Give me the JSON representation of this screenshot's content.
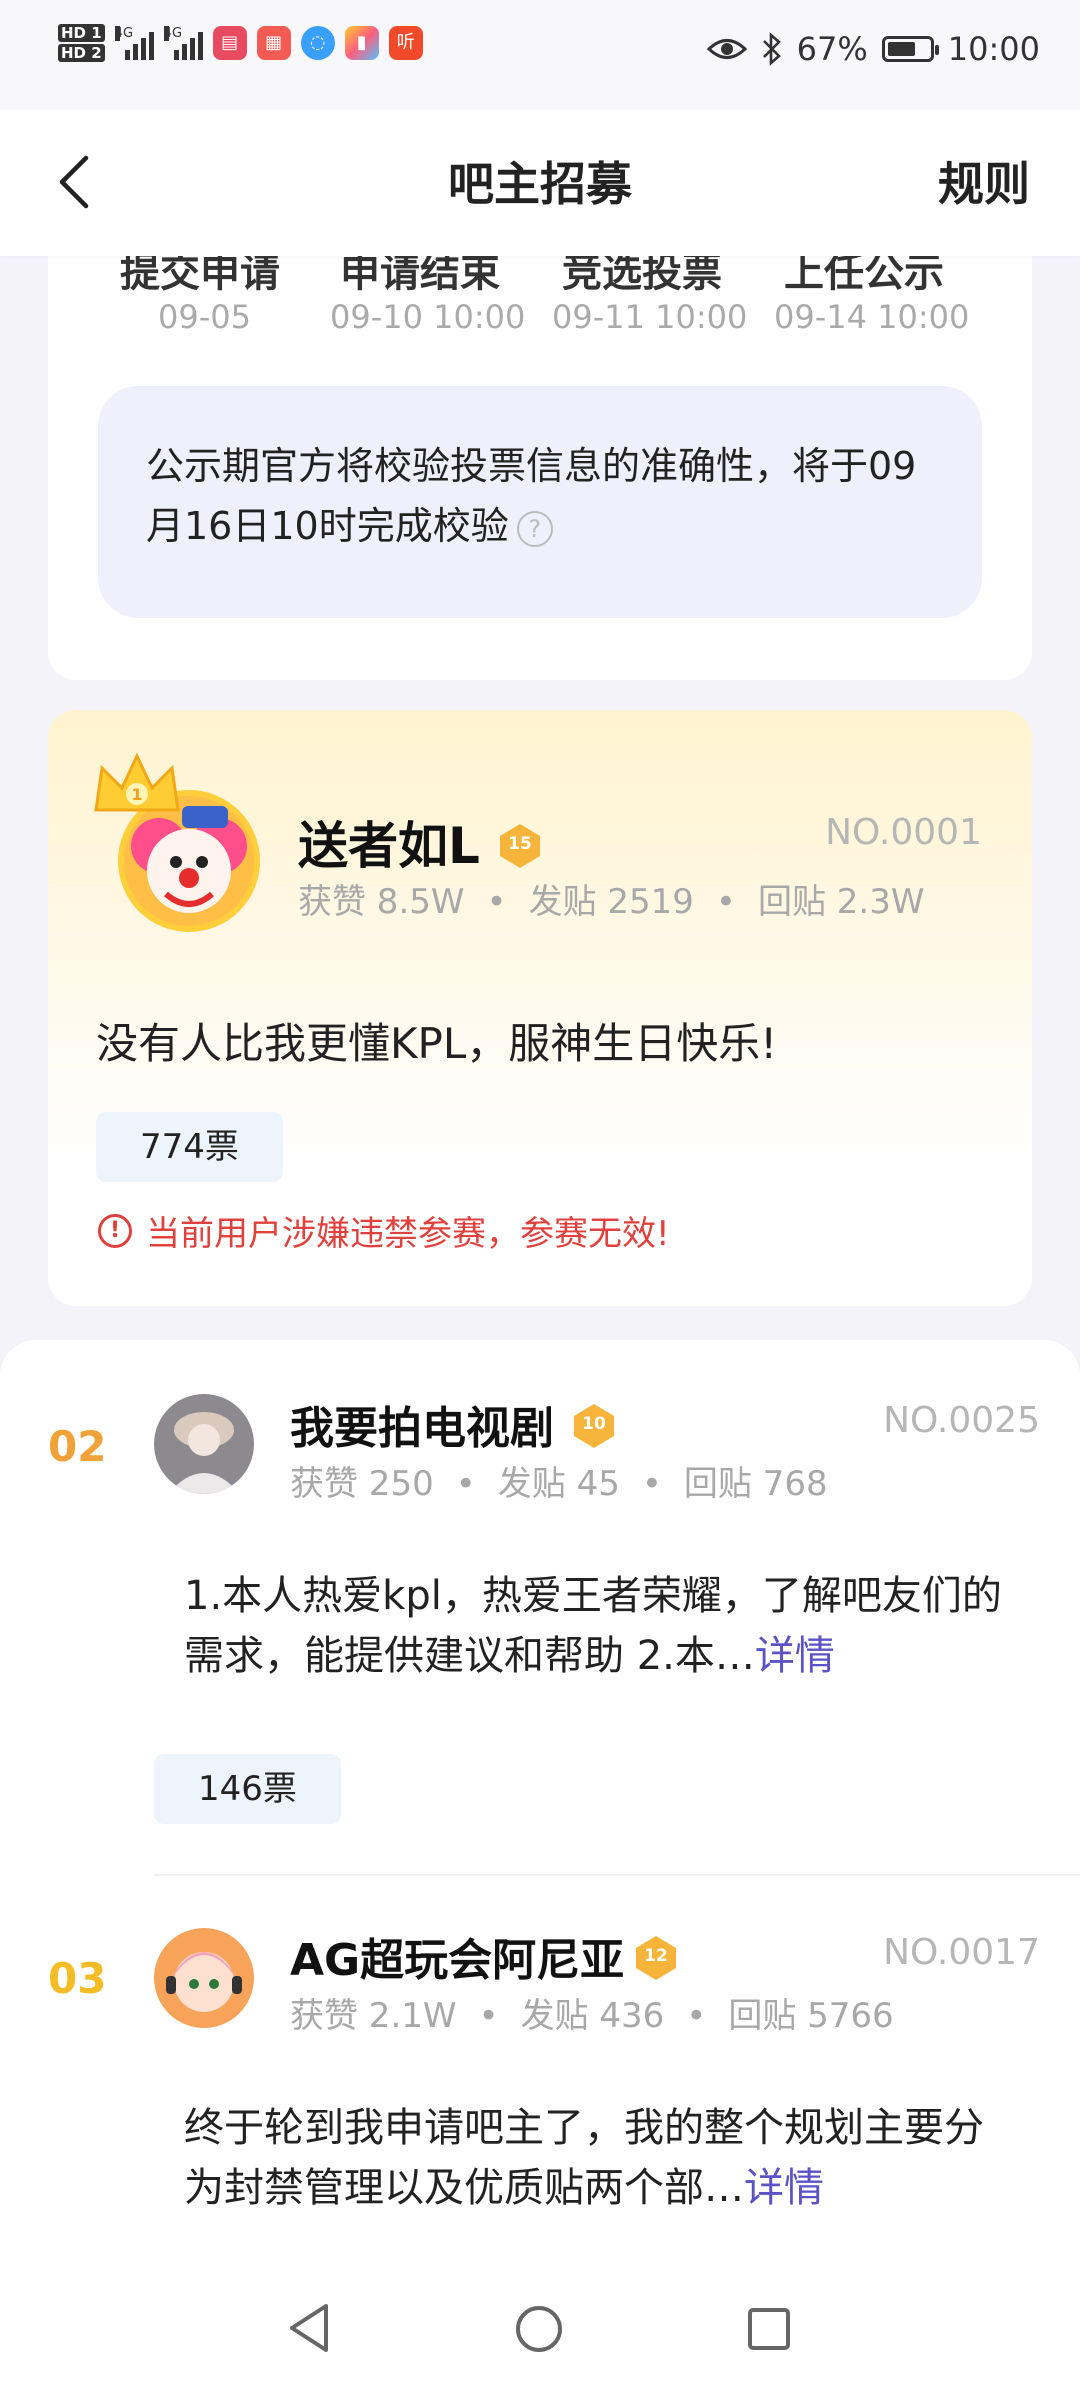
{
  "status_bar": {
    "hd1": "HD 1",
    "hd2": "HD 2",
    "net1": "4G",
    "net2": "4G",
    "apps": [
      "read-app-icon",
      "grid-app-icon",
      "chat-app-icon",
      "flag-app-icon",
      "listen-app-icon"
    ],
    "listen_glyph": "听",
    "battery_text": "67%",
    "battery_level": 0.67,
    "time": "10:00"
  },
  "nav": {
    "title": "吧主招募",
    "rules": "规则"
  },
  "steps": [
    {
      "name": "提交申请",
      "date": "09-05"
    },
    {
      "name": "申请结束",
      "date": "09-10 10:00"
    },
    {
      "name": "竞选投票",
      "date": "09-11 10:00"
    },
    {
      "name": "上任公示",
      "date": "09-14 10:00"
    }
  ],
  "notice": {
    "text": "公示期官方将校验投票信息的准确性，将于09月16日10时完成校验",
    "help": "?"
  },
  "top_candidate": {
    "crown_rank": "1",
    "name": "送者如L",
    "level": "15",
    "number": "NO.0001",
    "likes": "获赞 8.5W",
    "posts": "发贴 2519",
    "replies": "回贴 2.3W",
    "intro": "没有人比我更懂KPL，服神生日快乐!",
    "votes": "774票",
    "warning": "当前用户涉嫌违禁参赛，参赛无效!",
    "warn_icon": "!"
  },
  "candidates": [
    {
      "rank": "02",
      "name": "我要拍电视剧",
      "level": "10",
      "number": "NO.0025",
      "likes": "获赞 250",
      "posts": "发贴 45",
      "replies": "回贴 768",
      "intro": "1.本人热爱kpl，热爱王者荣耀，了解吧友们的需求，能提供建议和帮助 2.本…",
      "more": "详情",
      "votes": "146票"
    },
    {
      "rank": "03",
      "name": "AG超玩会阿尼亚",
      "level": "12",
      "number": "NO.0017",
      "likes": "获赞 2.1W",
      "posts": "发贴 436",
      "replies": "回贴 5766",
      "intro": "终于轮到我申请吧主了，我的整个规划主要分为封禁管理以及优质贴两个部…",
      "more": "详情"
    }
  ],
  "colors": {
    "accent": "#5b52c6",
    "rank2": "#f0a238",
    "rank3": "#f5bd25",
    "warning": "#e0413c",
    "badge": "#f6b53a"
  },
  "system_nav": [
    "back-triangle-icon",
    "home-circle-icon",
    "recents-square-icon"
  ]
}
